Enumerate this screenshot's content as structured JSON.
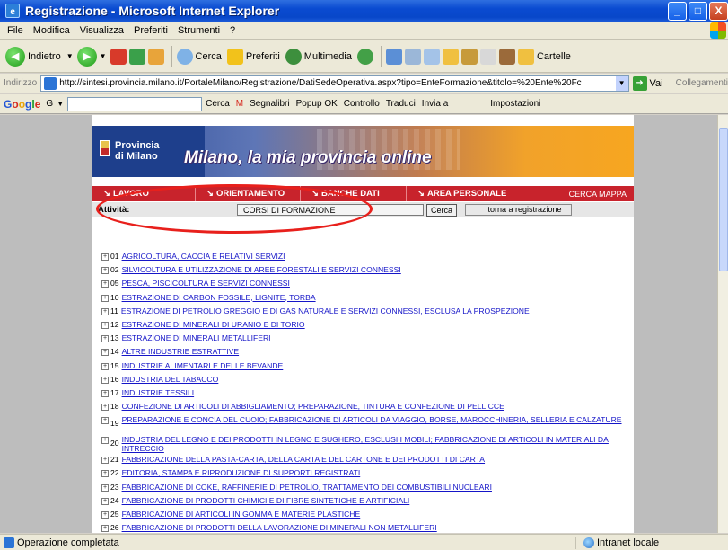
{
  "window": {
    "title": "Registrazione - Microsoft Internet Explorer",
    "icon": "ie-icon",
    "controls": [
      "_",
      "□",
      "X"
    ]
  },
  "menu": [
    "File",
    "Modifica",
    "Visualizza",
    "Preferiti",
    "Strumenti",
    "?"
  ],
  "toolbar": {
    "back": "Indietro",
    "search": "Cerca",
    "favorites": "Preferiti",
    "multimedia": "Multimedia",
    "folders": "Cartelle"
  },
  "address": {
    "label": "Indirizzo",
    "url": "http://sintesi.provincia.milano.it/PortaleMilano/Registrazione/DatiSedeOperativa.aspx?tipo=EnteFormazione&titolo=%20Ente%20Fc",
    "go": "Vai",
    "links": "Collegamenti"
  },
  "google": {
    "logo": "Google",
    "g": "G",
    "search": "Cerca",
    "bookmarks": "Segnalibri",
    "popup": "Popup OK",
    "check": "Controllo",
    "translate": "Traduci",
    "send": "Invia a",
    "settings": "Impostazioni"
  },
  "site": {
    "province_1": "Provincia",
    "province_2": "di Milano",
    "slogan": "Milano, la mia provincia online",
    "nav": [
      "LAVORO",
      "ORIENTAMENTO",
      "BANCHE DATI",
      "AREA PERSONALE"
    ],
    "nav_right": "CERCA  MAPPA",
    "activity_label": "Attività:",
    "activity_value": "CORSI DI FORMAZIONE",
    "search_button": "Cerca",
    "return_button": "torna a registrazione"
  },
  "categories": [
    {
      "code": "01",
      "label": "AGRICOLTURA, CACCIA E RELATIVI SERVIZI"
    },
    {
      "code": "02",
      "label": "SILVICOLTURA E UTILIZZAZIONE DI AREE FORESTALI E SERVIZI CONNESSI"
    },
    {
      "code": "05",
      "label": "PESCA, PISCICOLTURA E SERVIZI CONNESSI"
    },
    {
      "code": "10",
      "label": "ESTRAZIONE DI CARBON FOSSILE, LIGNITE, TORBA"
    },
    {
      "code": "11",
      "label": "ESTRAZIONE DI PETROLIO GREGGIO E DI GAS NATURALE E SERVIZI CONNESSI, ESCLUSA LA PROSPEZIONE"
    },
    {
      "code": "12",
      "label": "ESTRAZIONE DI MINERALI DI URANIO E DI TORIO"
    },
    {
      "code": "13",
      "label": "ESTRAZIONE DI MINERALI METALLIFERI"
    },
    {
      "code": "14",
      "label": "ALTRE INDUSTRIE ESTRATTIVE"
    },
    {
      "code": "15",
      "label": "INDUSTRIE ALIMENTARI E DELLE BEVANDE"
    },
    {
      "code": "16",
      "label": "INDUSTRIA DEL TABACCO"
    },
    {
      "code": "17",
      "label": "INDUSTRIE TESSILI"
    },
    {
      "code": "18",
      "label": "CONFEZIONE DI ARTICOLI DI ABBIGLIAMENTO; PREPARAZIONE, TINTURA E CONFEZIONE DI PELLICCE"
    },
    {
      "code": "19",
      "label": "PREPARAZIONE E CONCIA DEL CUOIO; FABBRICAZIONE DI ARTICOLI DA VIAGGIO, BORSE, MAROCCHINERIA, SELLERIA E CALZATURE",
      "two": true
    },
    {
      "code": "20",
      "label": "INDUSTRIA DEL LEGNO E DEI PRODOTTI IN LEGNO E SUGHERO, ESCLUSI I MOBILI; FABBRICAZIONE DI ARTICOLI IN MATERIALI DA INTRECCIO",
      "two": true
    },
    {
      "code": "21",
      "label": "FABBRICAZIONE DELLA PASTA-CARTA, DELLA CARTA E DEL CARTONE E DEI PRODOTTI DI CARTA"
    },
    {
      "code": "22",
      "label": "EDITORIA, STAMPA E RIPRODUZIONE DI SUPPORTI REGISTRATI"
    },
    {
      "code": "23",
      "label": "FABBRICAZIONE DI COKE, RAFFINERIE DI PETROLIO, TRATTAMENTO DEI COMBUSTIBILI NUCLEARI"
    },
    {
      "code": "24",
      "label": "FABBRICAZIONE DI PRODOTTI CHIMICI E DI FIBRE SINTETICHE E ARTIFICIALI"
    },
    {
      "code": "25",
      "label": "FABBRICAZIONE DI ARTICOLI IN GOMMA E MATERIE PLASTICHE"
    },
    {
      "code": "26",
      "label": "FABBRICAZIONE DI PRODOTTI DELLA LAVORAZIONE DI MINERALI NON METALLIFERI"
    }
  ],
  "status": {
    "text": "Operazione completata",
    "zone": "Intranet locale"
  },
  "colors": {
    "nav_red": "#c8232c",
    "link_blue": "#1515c8",
    "highlight": "#e8201c"
  }
}
